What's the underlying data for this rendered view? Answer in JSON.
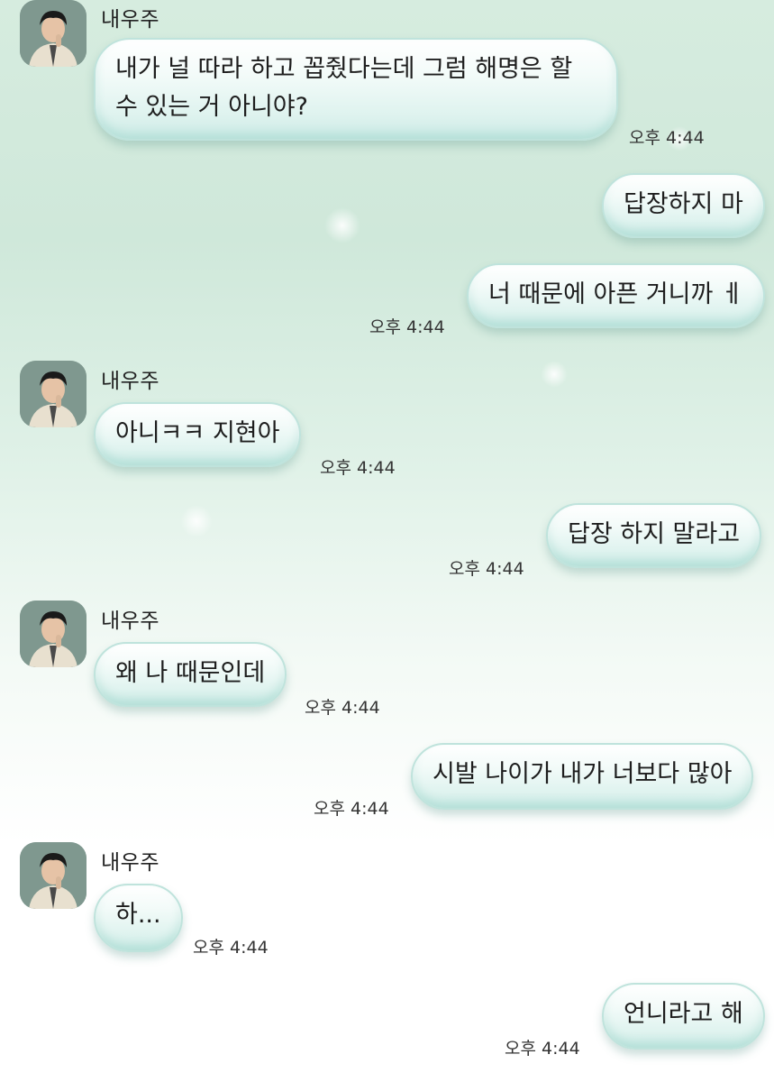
{
  "contact_name": "내우주",
  "messages": [
    {
      "side": "in",
      "text": "내가 널 따라 하고 꼽줬다는데 그럼 해명은 할 수 있는 거 아니야?",
      "time": "오후 4:44"
    },
    {
      "side": "out",
      "text": "답장하지 마",
      "time": ""
    },
    {
      "side": "out",
      "text": "너 때문에 아픈 거니까 ㅔ",
      "time": "오후 4:44"
    },
    {
      "side": "in",
      "text": "아니ㅋㅋ 지현아",
      "time": "오후 4:44"
    },
    {
      "side": "out",
      "text": "답장 하지 말라고",
      "time": "오후 4:44"
    },
    {
      "side": "in",
      "text": "왜 나 때문인데",
      "time": "오후 4:44"
    },
    {
      "side": "out",
      "text": "시발 나이가 내가 너보다 많아",
      "time": "오후 4:44"
    },
    {
      "side": "in",
      "text": "하...",
      "time": "오후 4:44"
    },
    {
      "side": "out",
      "text": "언니라고 해",
      "time": "오후 4:44"
    }
  ]
}
